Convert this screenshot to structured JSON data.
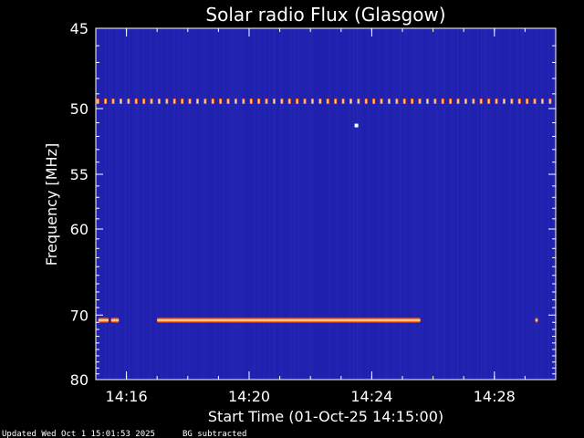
{
  "chart_data": {
    "type": "heatmap",
    "title": "Solar radio Flux (Glasgow)",
    "xlabel": "Start Time (01-Oct-25 14:15:00)",
    "ylabel": "Frequency [MHz]",
    "xlim": [
      "14:15:00",
      "14:30:00"
    ],
    "ylim": [
      45,
      80
    ],
    "y_scale": "reciprocal",
    "x_ticks": [
      "14:16",
      "14:20",
      "14:24",
      "14:28"
    ],
    "y_ticks": [
      45,
      50,
      55,
      60,
      70,
      80
    ],
    "colors": {
      "background": "#1a1aa8",
      "intense": "#ff6a1a",
      "peak": "#ffffff",
      "axis": "#ffffff"
    },
    "features": [
      {
        "type": "dotted-line",
        "frequency": 49.5,
        "start": "14:15:00",
        "end": "14:30:00",
        "spacing_seconds": 15
      },
      {
        "type": "point",
        "frequency": 51.2,
        "time": "14:23:30"
      },
      {
        "type": "segment",
        "frequency": 70.7,
        "start": "14:15:05",
        "end": "14:15:25"
      },
      {
        "type": "segment",
        "frequency": 70.7,
        "start": "14:15:30",
        "end": "14:15:45"
      },
      {
        "type": "segment",
        "frequency": 70.7,
        "start": "14:17:00",
        "end": "14:25:35"
      },
      {
        "type": "segment",
        "frequency": 70.7,
        "start": "14:29:20",
        "end": "14:29:25"
      }
    ]
  },
  "footer": {
    "updated": "Updated Wed Oct  1 15:01:53 2025",
    "note": "BG subtracted"
  }
}
